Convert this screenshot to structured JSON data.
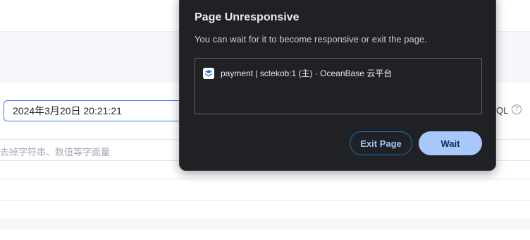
{
  "background": {
    "date_value": "2024年3月20日 20:21:21",
    "sql_label": "QL",
    "help_glyph": "?",
    "hint_text": "去掉字符串、数值等字面量"
  },
  "dialog": {
    "title": "Page Unresponsive",
    "message": "You can wait for it to become responsive or exit the page.",
    "pages": [
      {
        "title": "payment | sctekob:1 (主) · OceanBase 云平台",
        "icon": "oceanbase-logo-icon"
      }
    ],
    "exit_label": "Exit Page",
    "wait_label": "Wait"
  },
  "colors": {
    "dialog_bg": "#202124",
    "wait_button": "#a8c7fa",
    "exit_border": "#1a73b8",
    "input_focus": "#3c78e8"
  }
}
